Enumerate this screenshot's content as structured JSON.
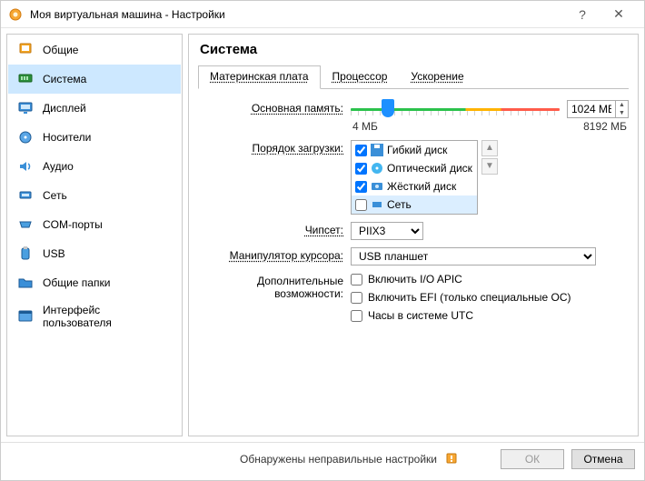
{
  "window": {
    "title": "Моя виртуальная машина - Настройки",
    "help": "?",
    "close": "✕"
  },
  "sidebar": {
    "items": [
      {
        "label": "Общие"
      },
      {
        "label": "Система"
      },
      {
        "label": "Дисплей"
      },
      {
        "label": "Носители"
      },
      {
        "label": "Аудио"
      },
      {
        "label": "Сеть"
      },
      {
        "label": "COM-порты"
      },
      {
        "label": "USB"
      },
      {
        "label": "Общие папки"
      },
      {
        "label": "Интерфейс пользователя"
      }
    ]
  },
  "main": {
    "heading": "Система",
    "tabs": {
      "motherboard": "Материнская плата",
      "processor": "Процессор",
      "accel": "Ускорение"
    },
    "labels": {
      "memory": "Основная память:",
      "boot": "Порядок загрузки:",
      "chipset": "Чипсет:",
      "pointer": "Манипулятор курсора:",
      "advanced": "Дополнительные возможности:"
    },
    "memory": {
      "value": "1024 МБ",
      "min": "4 МБ",
      "max": "8192 МБ"
    },
    "boot": {
      "items": [
        {
          "label": "Гибкий диск",
          "checked": true
        },
        {
          "label": "Оптический диск",
          "checked": true
        },
        {
          "label": "Жёсткий диск",
          "checked": true
        },
        {
          "label": "Сеть",
          "checked": false
        }
      ],
      "up": "▲",
      "down": "▼"
    },
    "chipset": {
      "value": "PIIX3"
    },
    "pointer": {
      "value": "USB планшет"
    },
    "adv": {
      "ioapic": "Включить I/O APIC",
      "efi": "Включить EFI (только специальные ОС)",
      "utc": "Часы в системе UTC"
    }
  },
  "footer": {
    "warning": "Обнаружены неправильные настройки",
    "ok": "ОК",
    "cancel": "Отмена"
  },
  "colors": {
    "accent": "#cde8ff"
  }
}
